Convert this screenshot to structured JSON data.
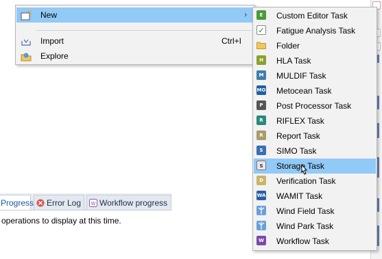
{
  "context_menu": {
    "items": [
      {
        "label": "New",
        "icon": "new-item-icon",
        "has_submenu": true,
        "highlighted": true
      },
      {
        "label": "Import",
        "icon": "import-icon",
        "shortcut": "Ctrl+I"
      },
      {
        "label": "Explore",
        "icon": "explore-icon"
      }
    ],
    "submenu_arrow": "›"
  },
  "submenu": {
    "items": [
      {
        "label": "Custom Editor Task",
        "icon": "custom-editor-task-icon",
        "badge": "E",
        "color": "#4a9a3a"
      },
      {
        "label": "Fatigue Analysis Task",
        "icon": "fatigue-analysis-task-icon",
        "badge": "✓",
        "color": "#f2f2f2"
      },
      {
        "label": "Folder",
        "icon": "folder-icon",
        "badge": "",
        "color": "#f0c75e"
      },
      {
        "label": "HLA Task",
        "icon": "hla-task-icon",
        "badge": "H",
        "color": "#8aa02e"
      },
      {
        "label": "MULDIF Task",
        "icon": "muldif-task-icon",
        "badge": "M",
        "color": "#3f7fa8"
      },
      {
        "label": "Metocean Task",
        "icon": "metocean-task-icon",
        "badge": "MO",
        "color": "#1f5fa0"
      },
      {
        "label": "Post Processor Task",
        "icon": "post-processor-task-icon",
        "badge": "P",
        "color": "#555555"
      },
      {
        "label": "RIFLEX Task",
        "icon": "riflex-task-icon",
        "badge": "R",
        "color": "#2a8a7a"
      },
      {
        "label": "Report Task",
        "icon": "report-task-icon",
        "badge": "R",
        "color": "#a89a6a"
      },
      {
        "label": "SIMO Task",
        "icon": "simo-task-icon",
        "badge": "S",
        "color": "#3a6fb0"
      },
      {
        "label": "Storage Task",
        "icon": "storage-task-icon",
        "badge": "S",
        "color": "#e8e8e8",
        "highlighted": true
      },
      {
        "label": "Verification Task",
        "icon": "verification-task-icon",
        "badge": "D",
        "color": "#c8b46a"
      },
      {
        "label": "WAMIT Task",
        "icon": "wamit-task-icon",
        "badge": "WA",
        "color": "#2a5fa8"
      },
      {
        "label": "Wind Field Task",
        "icon": "wind-field-task-icon",
        "badge": "",
        "color": "#6aa0d8"
      },
      {
        "label": "Wind Park Task",
        "icon": "wind-park-task-icon",
        "badge": "",
        "color": "#6aa0d8"
      },
      {
        "label": "Workflow Task",
        "icon": "workflow-task-icon",
        "badge": "W",
        "color": "#7a4aa8"
      }
    ]
  },
  "bottom_panel": {
    "tabs": [
      {
        "label": "Progress",
        "icon": "progress-icon",
        "active": true
      },
      {
        "label": "Error Log",
        "icon": "error-log-icon"
      },
      {
        "label": "Workflow progress",
        "icon": "workflow-progress-icon"
      }
    ],
    "message": "operations to display at this time."
  }
}
